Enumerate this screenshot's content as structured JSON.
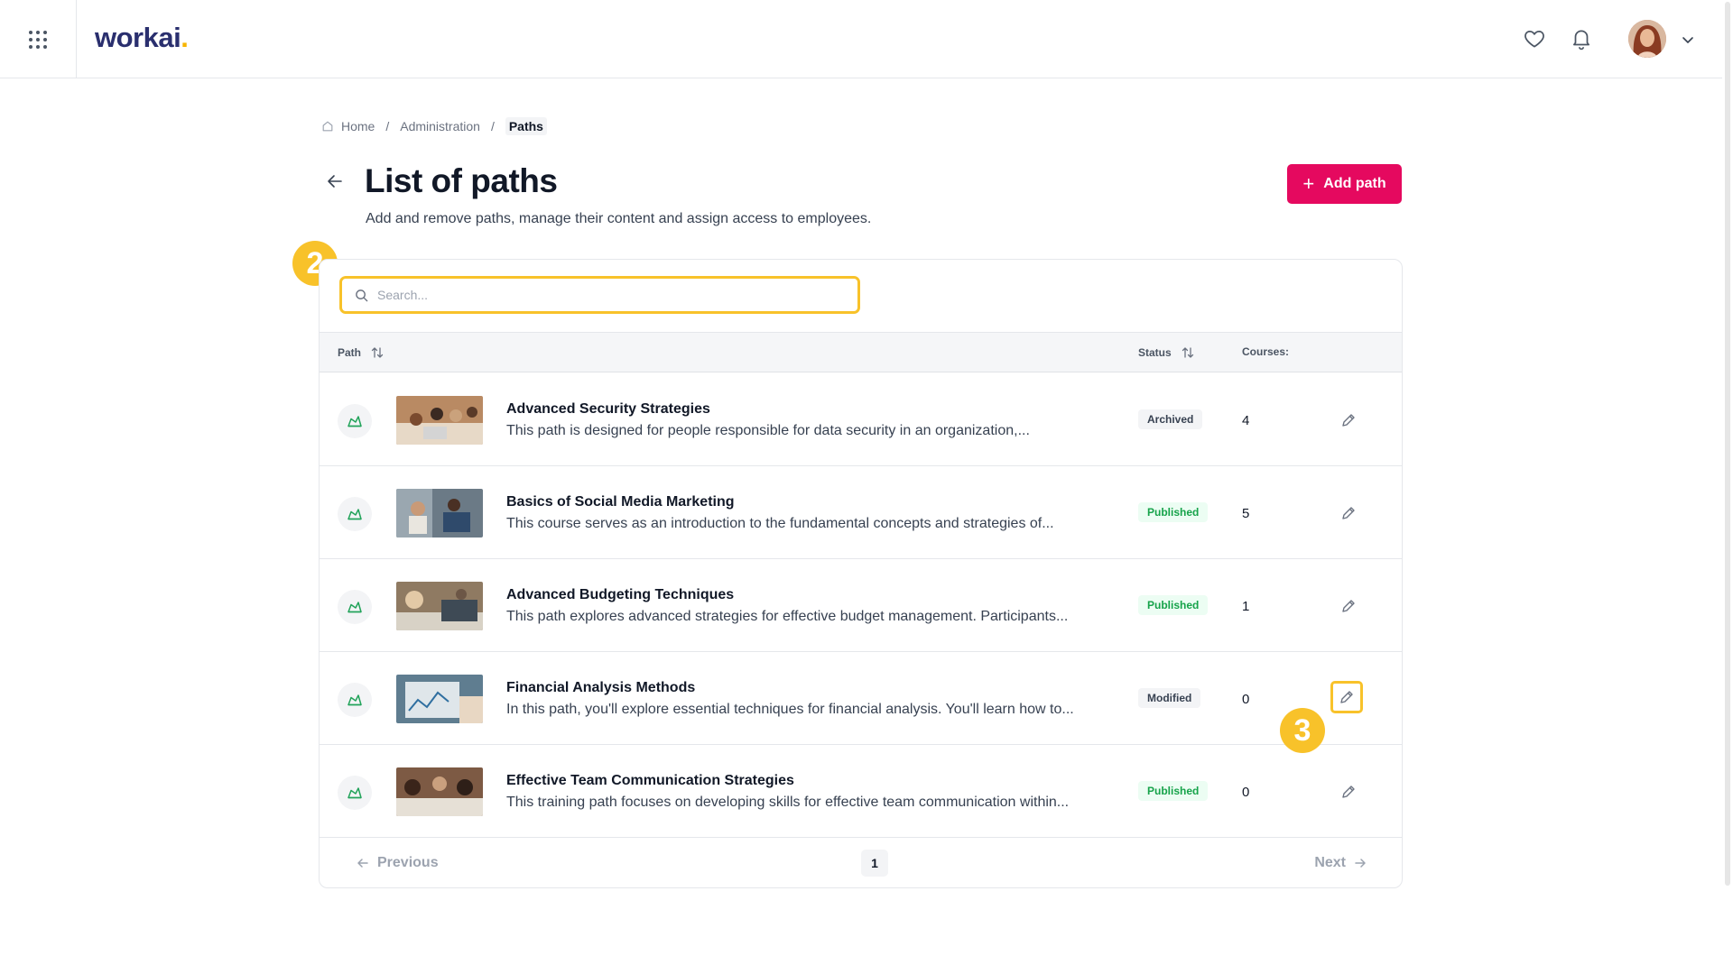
{
  "header": {
    "logo_text": "workai",
    "logo_dot": ".",
    "icons": [
      "apps-grid-icon",
      "heart-icon",
      "bell-icon",
      "chevron-down-icon"
    ]
  },
  "breadcrumb": {
    "home": "Home",
    "separator": "/",
    "admin": "Administration",
    "current": "Paths"
  },
  "page": {
    "title": "List of paths",
    "subtitle": "Add and remove paths, manage their content and assign access to employees.",
    "add_button": "Add path",
    "add_plus": "+"
  },
  "search": {
    "placeholder": "Search...",
    "value": ""
  },
  "table": {
    "columns": {
      "path": "Path",
      "status": "Status",
      "courses": "Courses:"
    },
    "rows": [
      {
        "title": "Advanced Security Strategies",
        "description": "This path is designed for people responsible for data security in an organization,...",
        "status": "Archived",
        "courses": "4"
      },
      {
        "title": "Basics of Social Media Marketing",
        "description": "This course serves as an introduction to the fundamental concepts and strategies of...",
        "status": "Published",
        "courses": "5"
      },
      {
        "title": "Advanced Budgeting Techniques",
        "description": "This path explores advanced strategies for effective budget management. Participants...",
        "status": "Published",
        "courses": "1"
      },
      {
        "title": "Financial Analysis Methods",
        "description": "In this path, you'll explore essential techniques for financial analysis. You'll learn how to...",
        "status": "Modified",
        "courses": "0"
      },
      {
        "title": "Effective Team Communication Strategies",
        "description": "This training path focuses on developing skills for effective team communication within...",
        "status": "Published",
        "courses": "0"
      }
    ]
  },
  "pagination": {
    "previous": "Previous",
    "current_page": "1",
    "next": "Next"
  },
  "annotations": {
    "step2": "2",
    "step3": "3"
  },
  "colors": {
    "accent": "#e5095f",
    "highlight": "#f8c22a",
    "published_text": "#16a34a",
    "path_icon": "#22a35a"
  }
}
